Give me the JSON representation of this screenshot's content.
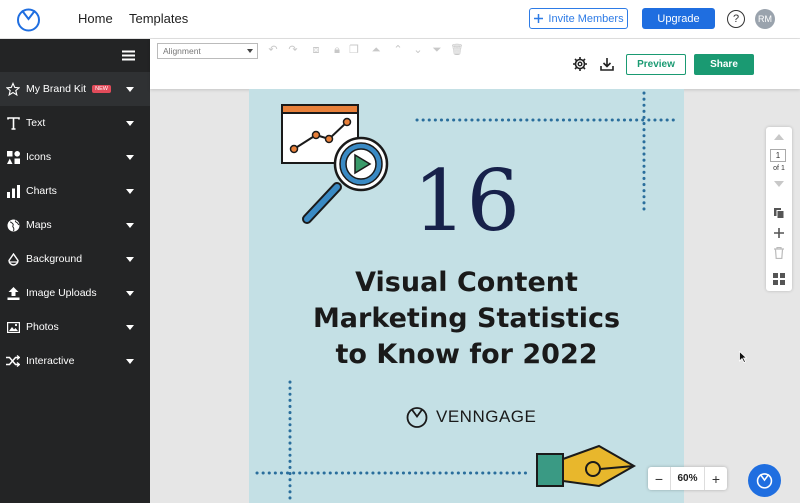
{
  "nav": {
    "home": "Home",
    "templates": "Templates"
  },
  "header": {
    "invite_label": "Invite Members",
    "upgrade_label": "Upgrade",
    "help": "?",
    "avatar_initials": "RM"
  },
  "sidebar": {
    "items": [
      {
        "label": "My Brand Kit",
        "badge": "NEW",
        "icon": "star-icon"
      },
      {
        "label": "Text",
        "icon": "text-icon"
      },
      {
        "label": "Icons",
        "icon": "shapes-icon"
      },
      {
        "label": "Charts",
        "icon": "bar-chart-icon"
      },
      {
        "label": "Maps",
        "icon": "globe-icon"
      },
      {
        "label": "Background",
        "icon": "paint-bucket-icon"
      },
      {
        "label": "Image Uploads",
        "icon": "upload-icon"
      },
      {
        "label": "Photos",
        "icon": "image-icon"
      },
      {
        "label": "Interactive",
        "icon": "shuffle-icon"
      }
    ]
  },
  "toolbar": {
    "alignment_value": "Alignment",
    "preview_label": "Preview",
    "share_label": "Share"
  },
  "canvas": {
    "number": "16",
    "headline_lines": [
      "Visual Content",
      "Marketing Statistics",
      "to Know for 2022"
    ],
    "brand_name": "VENNGAGE",
    "background_color": "#c4e0e5"
  },
  "pages": {
    "current": "1",
    "of": "of 1"
  },
  "zoom": {
    "value": "60%"
  },
  "colors": {
    "accent_blue": "#1f6ee0",
    "accent_green": "#1a9a72",
    "sidebar_bg": "#232425",
    "dotted_blue": "#2a6e9c",
    "navy": "#17214a",
    "orange": "#e8803a",
    "yellow": "#e8b72c",
    "teal": "#3a9a84"
  }
}
